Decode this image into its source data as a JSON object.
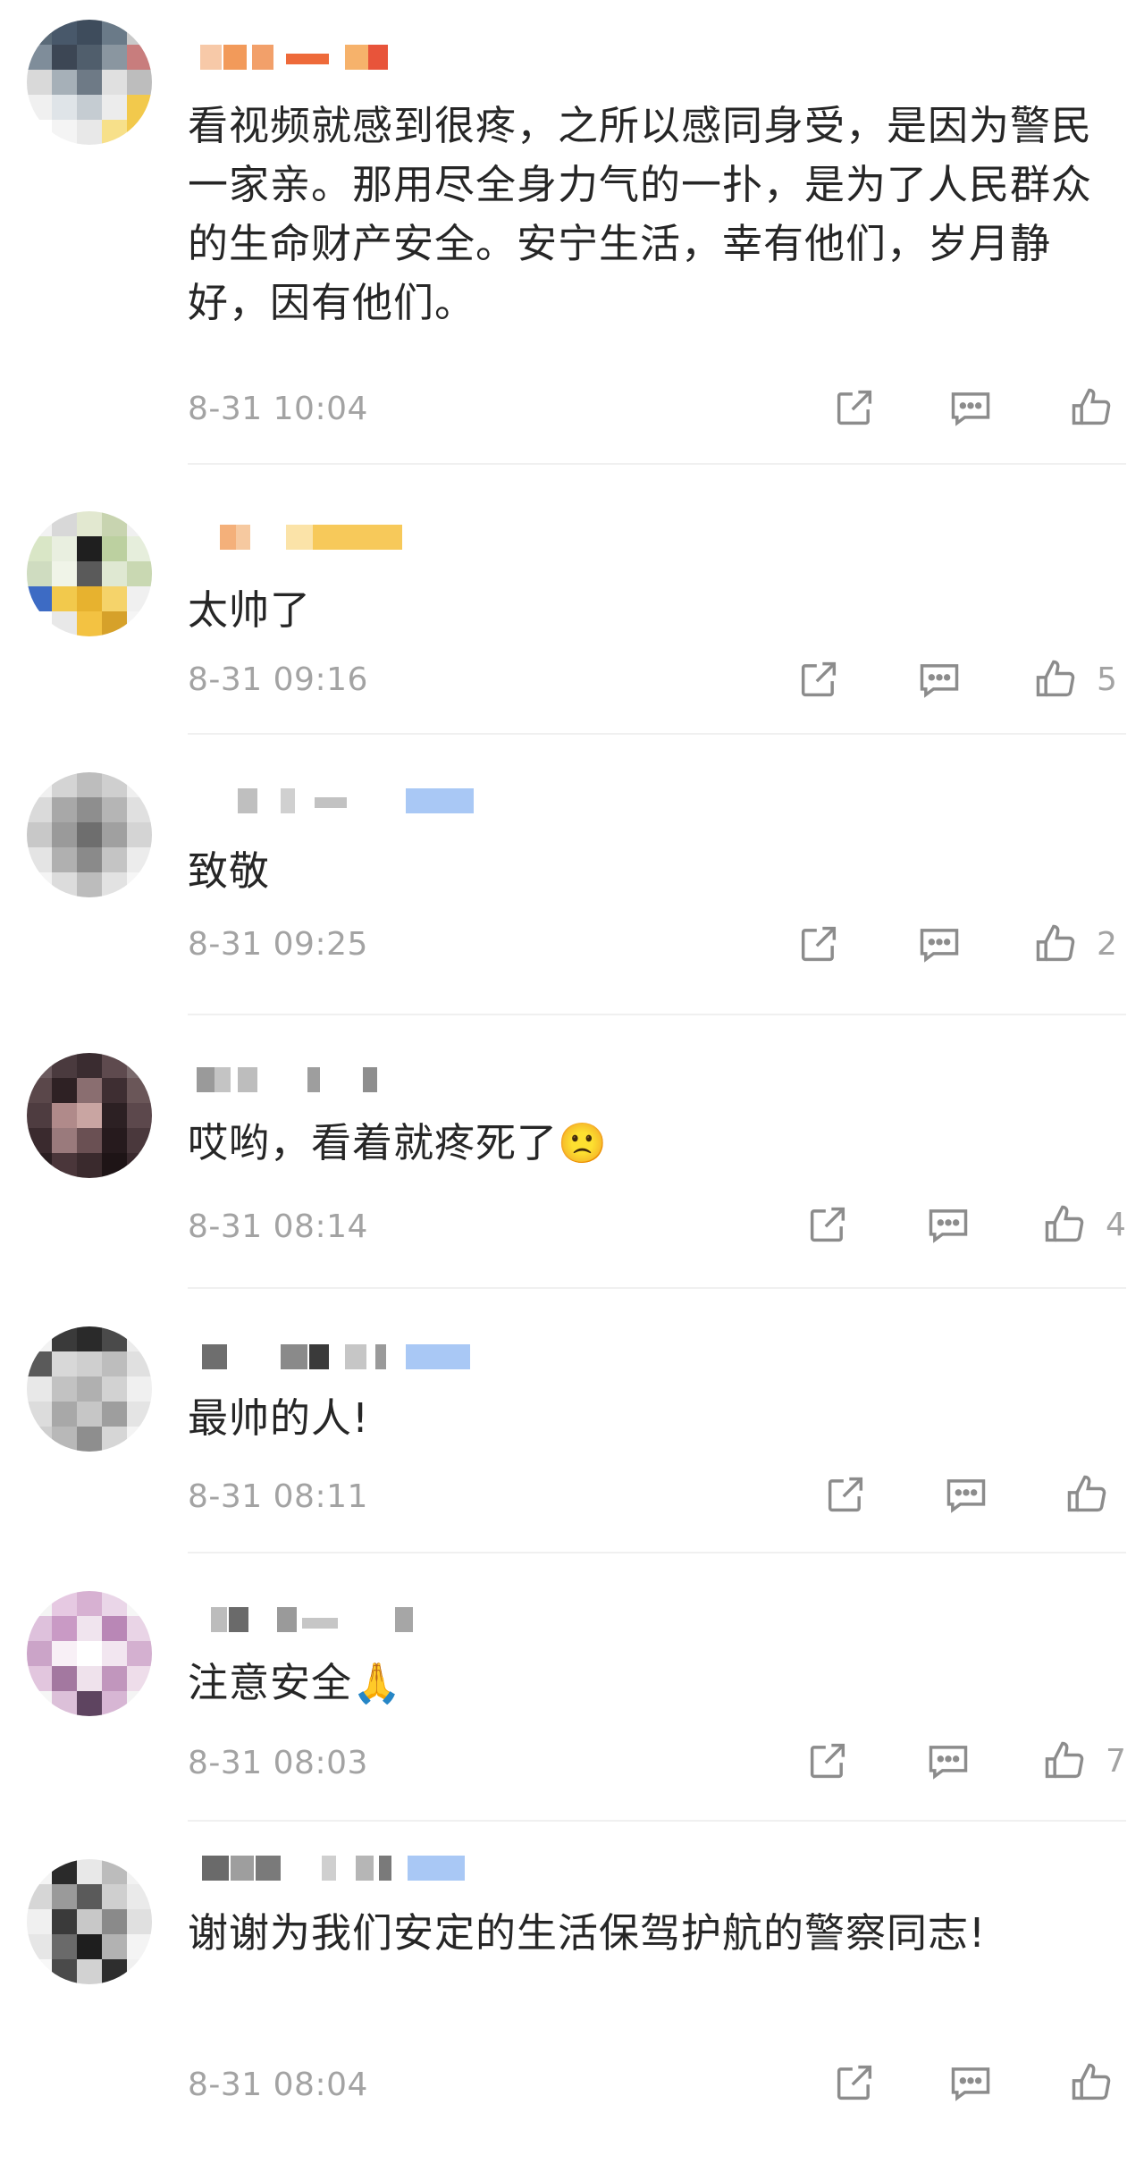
{
  "comments": [
    {
      "text": "看视频就感到很疼，之所以感同身受，是因为警民一家亲。那用尽全身力气的一扑，是为了人民群众的生命财产安全。安宁生活，幸有他们，岁月静好，因有他们。",
      "time": "8-31 10:04",
      "likes": ""
    },
    {
      "text": "太帅了",
      "time": "8-31 09:16",
      "likes": "5"
    },
    {
      "text": "致敬",
      "time": "8-31 09:25",
      "likes": "2"
    },
    {
      "text": "哎哟，看着就疼死了",
      "emoji": "🙁",
      "time": "8-31 08:14",
      "likes": "4"
    },
    {
      "text": "最帅的人!",
      "time": "8-31 08:11",
      "likes": ""
    },
    {
      "text": "注意安全",
      "emoji": "🙏",
      "time": "8-31 08:03",
      "likes": "7"
    },
    {
      "text": "谢谢为我们安定的生活保驾护航的警察同志!",
      "time": "8-31 08:04",
      "likes": ""
    }
  ],
  "icons": {
    "share": "share-icon",
    "comment": "comment-icon",
    "like": "thumbs-up-icon"
  },
  "colors": {
    "meta_gray": "#a3a3a3",
    "icon_gray": "#8c8c8c",
    "text": "#262626"
  }
}
